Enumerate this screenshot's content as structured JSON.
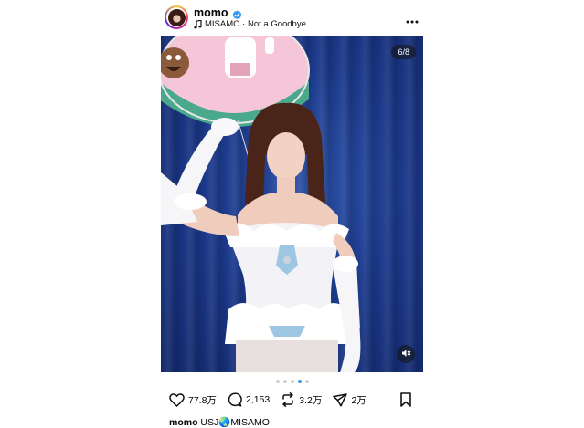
{
  "header": {
    "username": "momo",
    "music": "MISAMO · Not a Goodbye"
  },
  "carousel": {
    "counter": "6/8",
    "slide_count": 5,
    "active_index": 3
  },
  "actions": {
    "likes": "77.8万",
    "comments": "2,153",
    "reposts": "3.2万",
    "shares": "2万"
  },
  "caption": {
    "username": "momo",
    "text_before": "USJ",
    "emoji": "🌏",
    "text_after": "MISAMO"
  },
  "colors": {
    "verified": "#3897f0",
    "dot_active": "#3897f0",
    "background_curtain": "#1c3a8c"
  }
}
